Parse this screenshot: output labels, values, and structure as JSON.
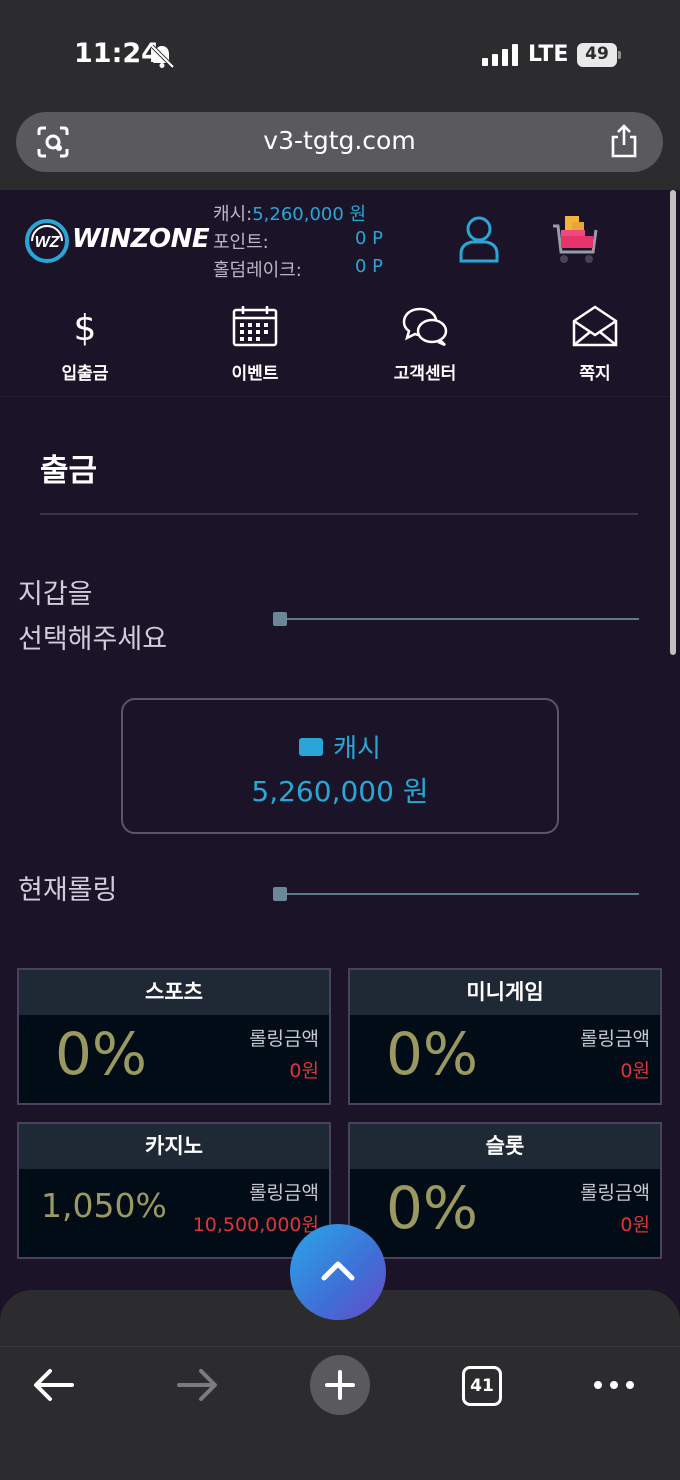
{
  "status_bar": {
    "time": "11:24",
    "network": "LTE",
    "battery": "49"
  },
  "browser": {
    "url": "v3-tgtg.com",
    "tab_count": "41"
  },
  "header": {
    "logo_text": "WINZONE",
    "cash_label": "캐시:",
    "cash_value": "5,260,000 원",
    "point_label": "포인트:",
    "point_value": "0 P",
    "holdem_label": "홀덤레이크:",
    "holdem_value": "0 P"
  },
  "nav": [
    {
      "label": "입출금",
      "icon": "dollar-icon"
    },
    {
      "label": "이벤트",
      "icon": "calendar-icon"
    },
    {
      "label": "고객센터",
      "icon": "chat-bubbles-icon"
    },
    {
      "label": "쪽지",
      "icon": "envelope-icon"
    }
  ],
  "withdraw": {
    "title": "출금",
    "wallet_label_line1": "지갑을",
    "wallet_label_line2": "선택해주세요",
    "cash_card_label": "캐시",
    "cash_card_value": "5,260,000 원",
    "rolling_label": "현재롤링"
  },
  "rolling": [
    {
      "name": "스포츠",
      "percent": "0%",
      "amount_label": "롤링금액",
      "amount": "0원"
    },
    {
      "name": "미니게임",
      "percent": "0%",
      "amount_label": "롤링금액",
      "amount": "0원"
    },
    {
      "name": "카지노",
      "percent": "1,050%",
      "amount_label": "롤링금액",
      "amount": "10,500,000원"
    },
    {
      "name": "슬롯",
      "percent": "0%",
      "amount_label": "롤링금액",
      "amount": "0원"
    }
  ],
  "colors": {
    "accent": "#2aa6d6",
    "background": "#1b1428",
    "percent": "#9c9960",
    "amount": "#e0343a"
  }
}
